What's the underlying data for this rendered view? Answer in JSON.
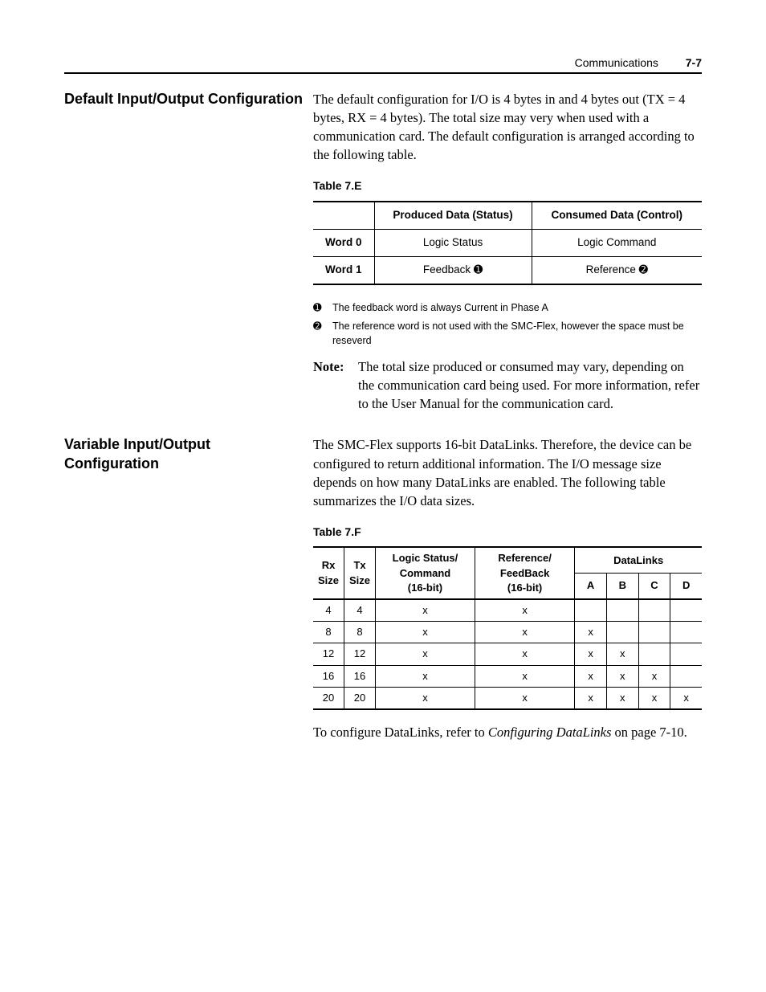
{
  "header": {
    "section": "Communications",
    "page": "7-7"
  },
  "sec1": {
    "heading": "Default Input/Output Configuration",
    "para": "The default configuration for I/O is 4 bytes in and 4 bytes out (TX = 4 bytes, RX = 4 bytes). The total size may very when used with a communication card. The default configuration is arranged according to the following table.",
    "table_caption": "Table 7.E",
    "table": {
      "h1": "",
      "h2": "Produced Data (Status)",
      "h3": "Consumed Data (Control)",
      "rows": [
        {
          "c1": "Word 0",
          "c2": "Logic Status",
          "c3": "Logic Command",
          "sym2": "",
          "sym3": ""
        },
        {
          "c1": "Word 1",
          "c2": "Feedback ",
          "c3": "Reference ",
          "sym2": "➊",
          "sym3": "➋"
        }
      ]
    },
    "foot1_sym": "➊",
    "foot1": "The feedback word is always Current in Phase A",
    "foot2_sym": "➋",
    "foot2": "The reference word is not used with the SMC-Flex, however the space must be reseverd",
    "note_label": "Note:",
    "note": "The total size produced or consumed may vary, depending on the communication card being used. For more information, refer to the User Manual for the communication card."
  },
  "sec2": {
    "heading": "Variable Input/Output Configuration",
    "para": "The SMC-Flex supports 16-bit DataLinks. Therefore, the device can be configured to return additional information. The I/O message size depends on how many DataLinks are enabled. The following table summarizes the I/O data sizes.",
    "table_caption": "Table 7.F",
    "table": {
      "h_rx1": "Rx",
      "h_rx2": "Size",
      "h_tx1": "Tx",
      "h_tx2": "Size",
      "h_ls1": "Logic Status/",
      "h_ls2": "Command",
      "h_ls3": "(16-bit)",
      "h_rf1": "Reference/",
      "h_rf2": "FeedBack",
      "h_rf3": "(16-bit)",
      "h_dl": "DataLinks",
      "h_a": "A",
      "h_b": "B",
      "h_c": "C",
      "h_d": "D",
      "rows": [
        {
          "rx": "4",
          "tx": "4",
          "ls": "x",
          "rf": "x",
          "a": "",
          "b": "",
          "c": "",
          "d": ""
        },
        {
          "rx": "8",
          "tx": "8",
          "ls": "x",
          "rf": "x",
          "a": "x",
          "b": "",
          "c": "",
          "d": ""
        },
        {
          "rx": "12",
          "tx": "12",
          "ls": "x",
          "rf": "x",
          "a": "x",
          "b": "x",
          "c": "",
          "d": ""
        },
        {
          "rx": "16",
          "tx": "16",
          "ls": "x",
          "rf": "x",
          "a": "x",
          "b": "x",
          "c": "x",
          "d": ""
        },
        {
          "rx": "20",
          "tx": "20",
          "ls": "x",
          "rf": "x",
          "a": "x",
          "b": "x",
          "c": "x",
          "d": "x"
        }
      ]
    },
    "closing_pre": "To configure DataLinks, refer to ",
    "closing_em": "Configuring DataLinks",
    "closing_post": " on page 7-10."
  }
}
